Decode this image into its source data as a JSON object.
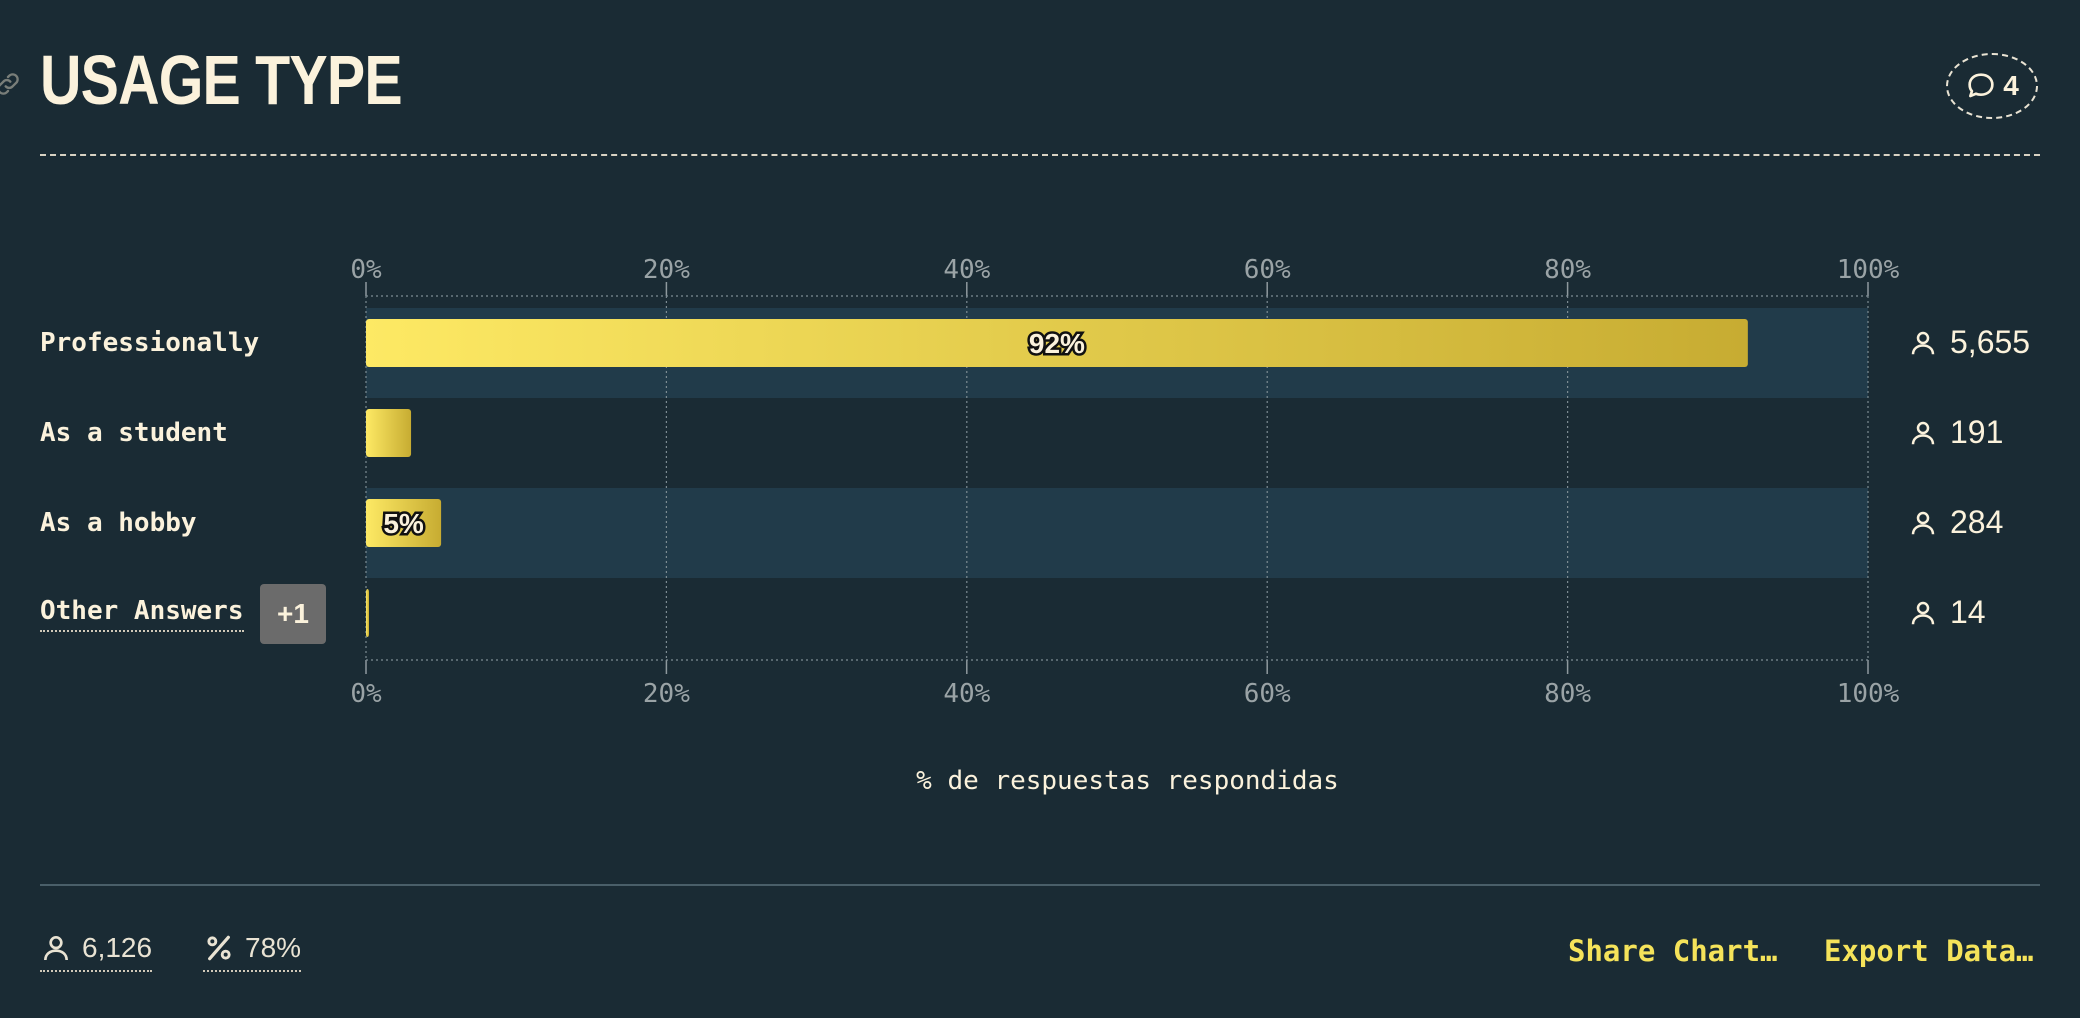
{
  "header": {
    "title": "USAGE TYPE",
    "comment_count": "4",
    "link_icon": "link-icon",
    "comment_icon": "speech-bubble-icon"
  },
  "chart_data": {
    "type": "bar",
    "orientation": "horizontal",
    "categories": [
      "Professionally",
      "As a student",
      "As a hobby",
      "Other Answers"
    ],
    "values": [
      92,
      3,
      5,
      0.2
    ],
    "data_labels": [
      "92%",
      "",
      "5%",
      ""
    ],
    "counts": [
      "5,655",
      "191",
      "284",
      "14"
    ],
    "xlabel": "% de respuestas respondidas",
    "xlim": [
      0,
      100
    ],
    "xticks": [
      "0%",
      "20%",
      "40%",
      "60%",
      "80%",
      "100%"
    ],
    "grid": true,
    "colors": {
      "bar_start": "#fde964",
      "bar_end": "#c7ac32",
      "band": "#213b4a",
      "background": "#1a2b34"
    }
  },
  "other_answers_badge": "+1",
  "footer": {
    "respondents": "6,126",
    "percent": "78%",
    "share_label": "Share Chart…",
    "export_label": "Export Data…",
    "accent": "#f5e35a"
  }
}
